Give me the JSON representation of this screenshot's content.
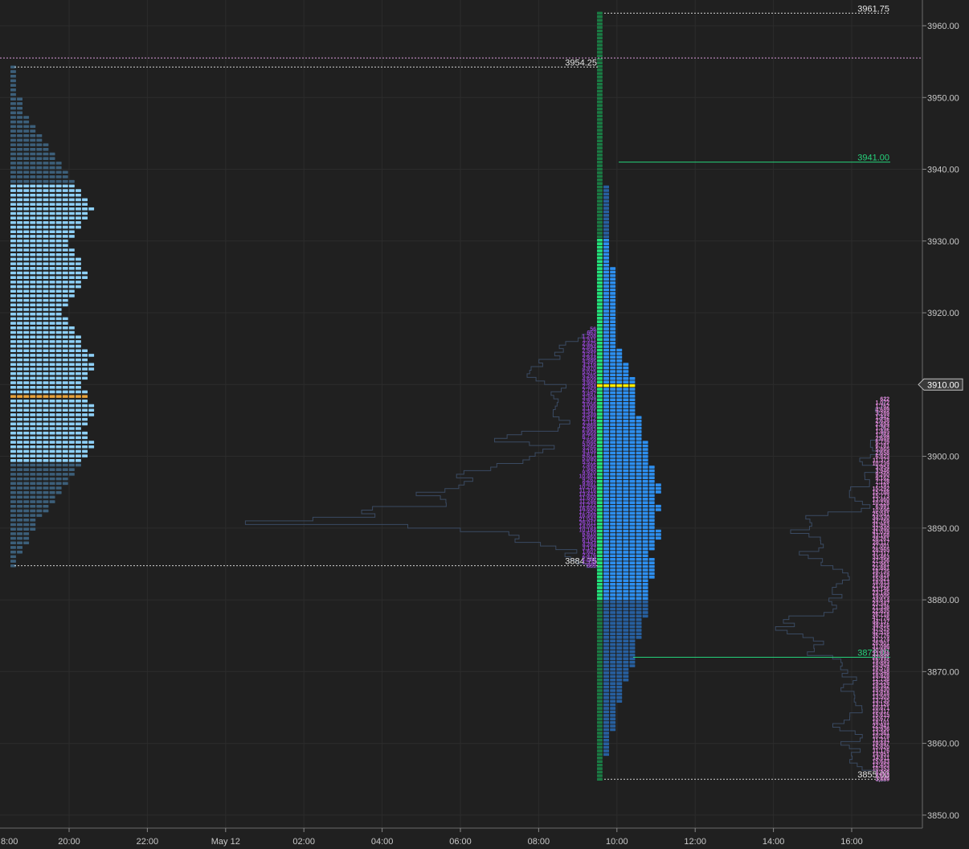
{
  "chart_data": {
    "type": "market-profile",
    "y_axis": {
      "min": 3846,
      "max": 3964,
      "ticks": [
        "3960.00",
        "3950.00",
        "3940.00",
        "3930.00",
        "3920.00",
        "3910.00",
        "3900.00",
        "3890.00",
        "3880.00",
        "3870.00",
        "3860.00",
        "3850.00"
      ],
      "current_price_label": "3910.00",
      "current_price": 3910
    },
    "x_axis": {
      "ticks": [
        {
          "label": "8:00",
          "t": 18
        },
        {
          "label": "20:00",
          "t": 20
        },
        {
          "label": "22:00",
          "t": 22
        },
        {
          "label": "May 12",
          "t": 24
        },
        {
          "label": "02:00",
          "t": 26
        },
        {
          "label": "04:00",
          "t": 28
        },
        {
          "label": "06:00",
          "t": 30
        },
        {
          "label": "08:00",
          "t": 32
        },
        {
          "label": "10:00",
          "t": 34
        },
        {
          "label": "12:00",
          "t": 36
        },
        {
          "label": "14:00",
          "t": 38
        },
        {
          "label": "16:00",
          "t": 40
        }
      ]
    },
    "reference_levels": [
      {
        "label": "3961.75",
        "price": 3961.75,
        "kind": "high"
      },
      {
        "label": "3954.25",
        "price": 3954.25,
        "kind": "prior-high"
      },
      {
        "label": "3941.00",
        "price": 3941.0,
        "kind": "green"
      },
      {
        "label": "3884.75",
        "price": 3884.75,
        "kind": "prior-low"
      },
      {
        "label": "3872.00",
        "price": 3872.0,
        "kind": "green"
      },
      {
        "label": "3855.00",
        "price": 3855.0,
        "kind": "low"
      }
    ],
    "pink_line_price": 3955.5,
    "left_profile": {
      "low": 3884.75,
      "high": 3954.25,
      "poc": 3908.25,
      "value_area": [
        3899.25,
        3938.25
      ],
      "counts": [
        1,
        1,
        1,
        2,
        2,
        3,
        3,
        3,
        4,
        4,
        4,
        5,
        6,
        6,
        7,
        7,
        8,
        8,
        9,
        9,
        10,
        10,
        11,
        11,
        12,
        12,
        13,
        13,
        12,
        12,
        11,
        12,
        12,
        13,
        13,
        13,
        12,
        12,
        12,
        11,
        11,
        12,
        12,
        13,
        13,
        12,
        13,
        12,
        11,
        11,
        11,
        10,
        10,
        9,
        9,
        8,
        8,
        9,
        9,
        10,
        10,
        11,
        11,
        12,
        12,
        11,
        11,
        11,
        10,
        10,
        9,
        9,
        10,
        10,
        11,
        11,
        12,
        12,
        13,
        12,
        12,
        11,
        11,
        10,
        10,
        9,
        9,
        8,
        8,
        7,
        7,
        6,
        6,
        5,
        5,
        4,
        4,
        3,
        3,
        2,
        2,
        2,
        2,
        1,
        1,
        1,
        1,
        1,
        1,
        1
      ]
    },
    "right_profile": {
      "low": 3855.0,
      "high": 3961.75,
      "poc": 3910.0,
      "value_area": [
        3880.0,
        3930.5
      ],
      "counts": [
        1,
        1,
        1,
        1,
        1,
        1,
        1,
        2,
        2,
        2,
        2,
        2,
        2,
        2,
        3,
        3,
        3,
        3,
        3,
        3,
        3,
        3,
        4,
        4,
        4,
        4,
        4,
        4,
        5,
        5,
        5,
        5,
        6,
        6,
        6,
        6,
        6,
        6,
        6,
        6,
        7,
        7,
        7,
        7,
        7,
        7,
        8,
        8,
        8,
        8,
        8,
        8,
        8,
        8,
        8,
        8,
        8,
        9,
        9,
        9,
        9,
        9,
        9,
        8,
        8,
        9,
        9,
        9,
        10,
        10,
        10,
        9,
        9,
        9,
        9,
        9,
        10,
        10,
        9,
        9,
        9,
        10,
        10,
        10,
        9,
        9,
        9,
        9,
        9,
        8,
        8,
        8,
        8,
        8,
        8,
        8,
        7,
        7,
        7,
        7,
        7,
        7,
        7,
        6,
        6,
        6,
        6,
        6,
        6,
        6,
        6,
        6,
        6,
        6,
        5,
        5,
        5,
        5,
        4,
        4,
        4,
        4,
        3,
        3,
        3,
        3,
        3,
        3,
        3,
        3,
        3,
        3,
        3,
        3,
        3,
        3,
        3,
        3,
        3,
        3,
        3,
        3,
        3,
        3,
        3,
        2,
        2,
        2,
        2,
        2,
        2,
        2,
        2,
        2,
        2,
        2,
        2,
        2,
        2,
        2,
        2,
        2,
        2,
        2,
        2,
        2,
        2,
        2,
        1,
        1,
        1,
        1,
        1,
        1,
        1,
        1,
        1,
        1,
        1,
        1,
        1,
        1,
        1,
        1,
        1,
        1,
        1,
        1,
        1,
        1,
        1,
        1,
        1,
        1,
        1,
        1,
        1,
        1,
        1,
        1,
        1,
        1,
        1,
        1,
        1,
        1,
        1,
        1,
        1,
        1,
        1,
        1,
        1,
        1,
        1,
        1,
        1
      ]
    },
    "overnight_volumes": {
      "start_price": 3884.75,
      "step": 0.5,
      "values": [
        "889",
        "1,534",
        "2,064",
        "2,476",
        "1,607",
        "3,147",
        "4,284",
        "6,154",
        "5,860",
        "6,610",
        "10,184",
        "14,051",
        "26,011",
        "21,043",
        "16,469",
        "17,452",
        "16,650",
        "11,222",
        "11,246",
        "11,650",
        "13,432",
        "11,316",
        "10,298",
        "9,897",
        "9,267",
        "10,461",
        "9,920",
        "7,945",
        "7,495",
        "5,572",
        "5,090",
        "4,671",
        "4,104",
        "3,266",
        "5,095",
        "7,659",
        "6,738",
        "5,669",
        "2,983",
        "2,869",
        "2,118",
        "2,912",
        "3,349",
        "3,341",
        "3,189",
        "3,056",
        "2,973",
        "3,304",
        "3,497",
        "2,750",
        "2,394",
        "3,980",
        "4,609",
        "5,265",
        "5,075",
        "4,970",
        "4,119",
        "4,395",
        "2,844",
        "3,231",
        "2,594",
        "2,894",
        "2,425",
        "1,511",
        "1,208",
        "663",
        "56"
      ]
    },
    "rth_volumes": {
      "start_price": 3855.0,
      "step": 0.5,
      "values": [
        "3,889",
        "3,610",
        "4,302",
        "10,353",
        "12,453",
        "15,643",
        "14,611",
        "14,951",
        "11,176",
        "15,820",
        "19,447",
        "11,231",
        "10,278",
        "13,361",
        "19,936",
        "22,941",
        "18,101",
        "15,677",
        "15,615",
        "10,317",
        "10,471",
        "13,126",
        "13,735",
        "13,503",
        "13,818",
        "19,430",
        "18,342",
        "14,226",
        "12,738",
        "18,928",
        "16,548",
        "19,578",
        "18,904",
        "19,445",
        "22,991",
        "33,848",
        "30,887",
        "31,096",
        "26,901",
        "31,274",
        "35,776",
        "42,516",
        "47,515",
        "39,416",
        "44,137",
        "41,776",
        "26,718",
        "22,835",
        "21,338",
        "23,347",
        "24,614",
        "19,005",
        "23,145",
        "23,146",
        "21,423",
        "18,813",
        "15,821",
        "16,419",
        "18,735",
        "22,881",
        "27,961",
        "27,356",
        "33,463",
        "37,317",
        "28,965",
        "27,001",
        "28,117",
        "28,261",
        "33,168",
        "41,039",
        "32,940",
        "31,963",
        "32,769",
        "34,530",
        "25,041",
        "10,696",
        "6,991",
        "10,228",
        "13,460",
        "15,773",
        "15,788",
        "15,292",
        "7,191",
        "7,128",
        "9,162",
        "9,260",
        "3,946",
        "3,954",
        "10,239",
        "11,373",
        "6,823",
        "2,658",
        "5,865",
        "6,781",
        "6,739",
        "2,649",
        "1,284",
        "1,445",
        "1,262",
        "2,494",
        "2,638",
        "1,442",
        "3,289",
        "4,689",
        "1,762",
        "1,072",
        "622"
      ]
    }
  },
  "colors": {
    "background": "#202020",
    "grid": "#2c2c2c",
    "left_out": "#3c5f7a",
    "left_va": "#8ed0f7",
    "left_poc": "#e8a33c",
    "right_out": "#275f9f",
    "right_va": "#2d8ff0",
    "right_poc": "#ffee00",
    "green_bright": "#22e27a",
    "green_dark": "#1a7a43",
    "volume_purple": "#9445d0",
    "volume_pink": "#e58ce0",
    "outline": "#3a4a62",
    "level_green": "#25d17a",
    "axis_text": "#c8c8c8"
  }
}
